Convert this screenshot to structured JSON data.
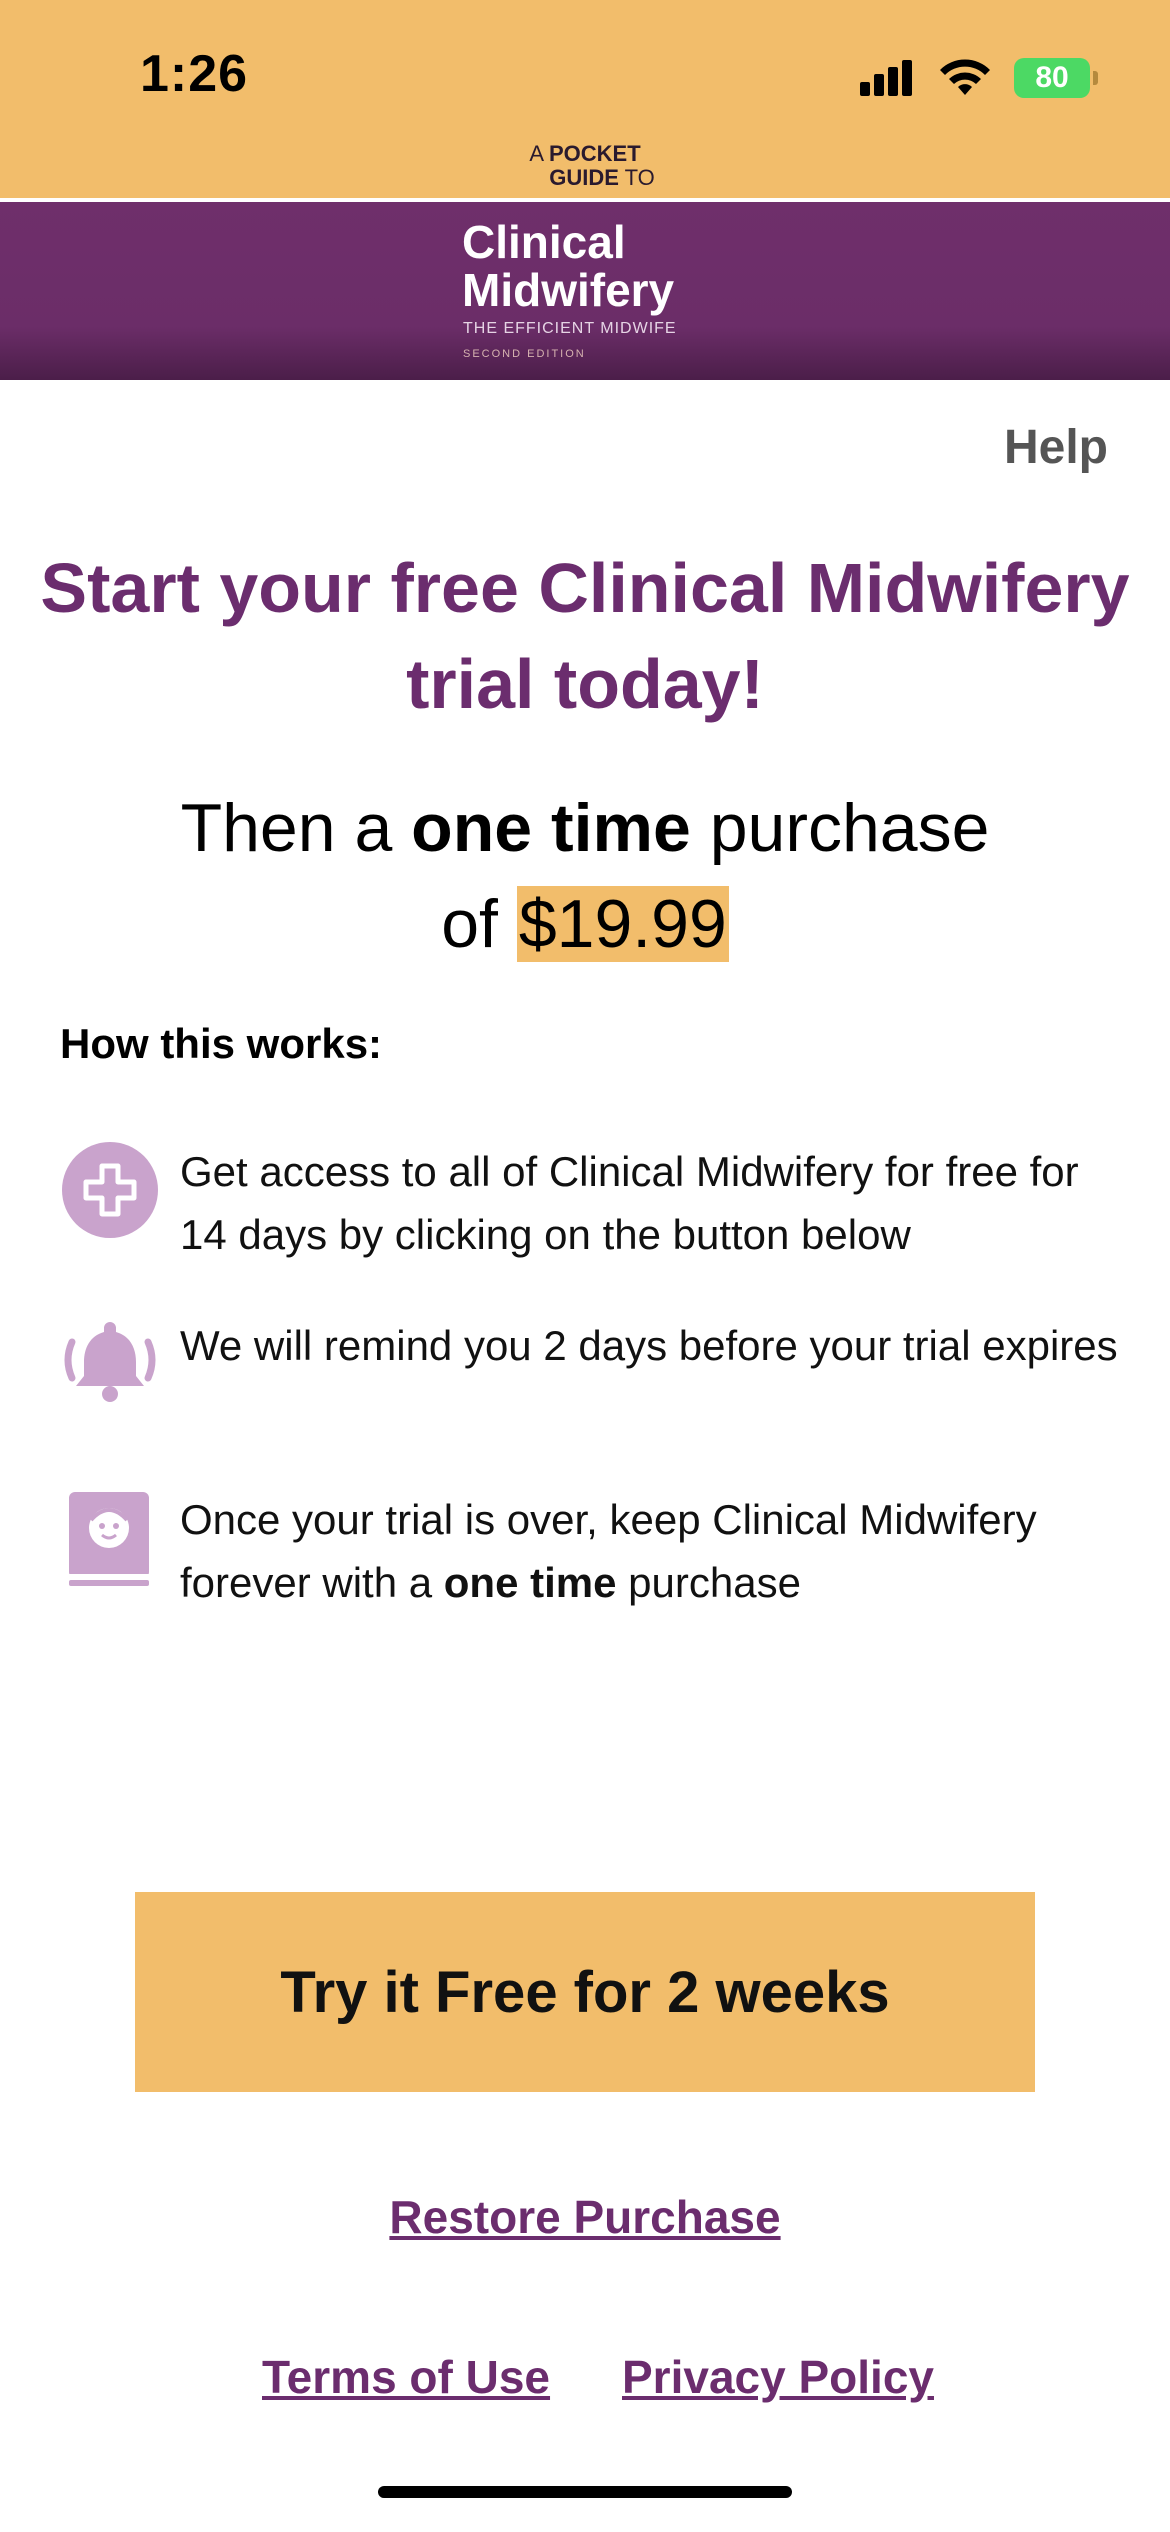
{
  "status_bar": {
    "time": "1:26",
    "battery_percent": "80",
    "colors": {
      "background": "#f2bd6b",
      "battery": "#4cd964"
    }
  },
  "banner": {
    "pre_a": "A",
    "pre_pocket": "POCKET",
    "pre_guide": "GUIDE",
    "pre_to": "TO",
    "title_line1": "Clinical",
    "title_line2": "Midwifery",
    "subtitle": "THE EFFICIENT MIDWIFE",
    "edition": "SECOND EDITION",
    "colors": {
      "purple": "#6b2d68"
    }
  },
  "help": "Help",
  "headline": "Start your free Clinical Midwifery trial today!",
  "price": {
    "then_a": "Then a",
    "one_time": "one time",
    "purchase": "purchase",
    "of": "of",
    "amount": "$19.99"
  },
  "how_title": "How this works:",
  "items": [
    {
      "icon": "medical-cross-icon",
      "text": "Get access to all of Clinical Midwifery for free for 14 days by clicking on the button below"
    },
    {
      "icon": "bell-ringing-icon",
      "text": "We will remind you 2 days before your trial expires"
    },
    {
      "icon": "baby-book-icon",
      "text_before": "Once your trial is over, keep Clinical Midwifery forever with a",
      "text_bold": "one time",
      "text_after": "purchase"
    }
  ],
  "cta_label": "Try it Free for 2 weeks",
  "restore_label": "Restore Purchase",
  "terms_label": "Terms of Use",
  "privacy_label": "Privacy Policy",
  "accent_colors": {
    "orange": "#f2bd6b",
    "purple": "#6b2d6e",
    "icon_lilac": "#c9a3cc"
  }
}
